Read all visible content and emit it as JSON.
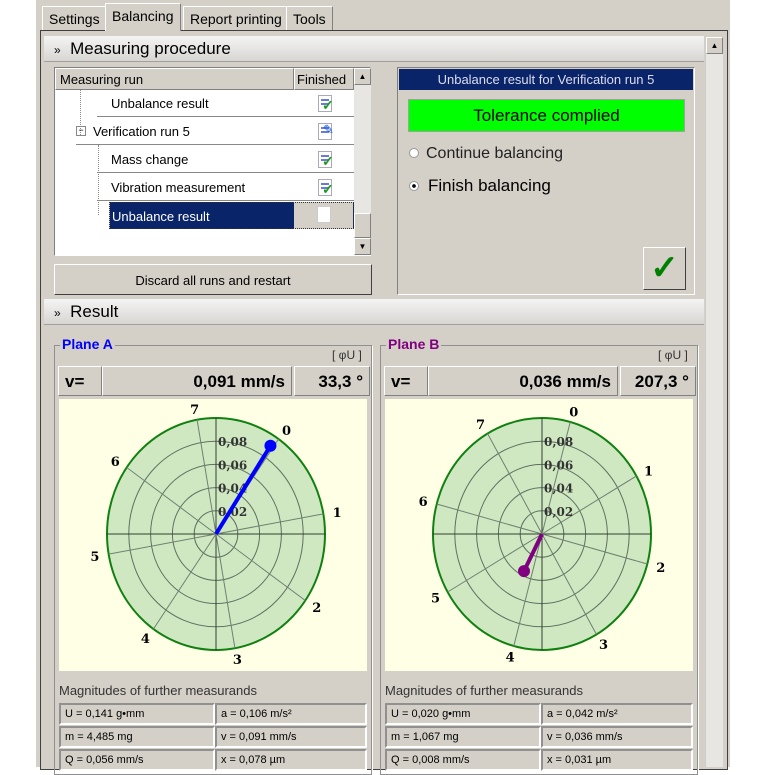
{
  "tabs": [
    {
      "label": "Settings"
    },
    {
      "label": "Balancing",
      "active": true
    },
    {
      "label": "Report printing"
    },
    {
      "label": "Tools"
    }
  ],
  "measuring_procedure": {
    "title": "Measuring procedure",
    "tree": {
      "columns": [
        "Measuring run",
        "Finished"
      ],
      "rows": [
        {
          "label": "Unbalance result",
          "status": "done-icon"
        },
        {
          "label": "Verification run 5",
          "status": "in-progress-icon",
          "expanded": true
        },
        {
          "label": "Mass change",
          "status": "done-icon"
        },
        {
          "label": "Vibration measurement",
          "status": "done-icon"
        },
        {
          "label": "Unbalance result",
          "status": "empty-doc-icon",
          "selected": true
        }
      ]
    },
    "discard_button": "Discard all runs and restart",
    "result_panel": {
      "title": "Unbalance result for Verification run 5",
      "status": "Tolerance complied",
      "status_color": "#00ff00",
      "options": [
        {
          "label": "Continue balancing",
          "selected": false
        },
        {
          "label": "Finish balancing",
          "selected": true
        }
      ],
      "confirm_icon": "checkmark-icon"
    }
  },
  "result": {
    "title": "Result",
    "unit_label": "[ φU ]",
    "measurands_title": "Magnitudes of further measurands",
    "planes": [
      {
        "name": "Plane A",
        "color": "#0000ff",
        "v_label": "v=",
        "velocity": "0,091 mm/s",
        "angle": "33,3 °",
        "measurands": [
          "U = 0,141 g•mm",
          "a = 0,106 m/s²",
          "m = 4,485 mg",
          "v = 0,091 mm/s",
          "Q = 0,056 mm/s",
          "x = 0,078 µm"
        ]
      },
      {
        "name": "Plane B",
        "color": "#800080",
        "v_label": "v=",
        "velocity": "0,036 mm/s",
        "angle": "207,3 °",
        "measurands": [
          "U = 0,020 g•mm",
          "a = 0,042 m/s²",
          "m = 1,067 mg",
          "v = 0,036 mm/s",
          "Q = 0,008 mm/s",
          "x = 0,031 µm"
        ]
      }
    ]
  },
  "chart_data": [
    {
      "type": "polar",
      "title": "Plane A",
      "radial_ticks": [
        "0,02",
        "0,04",
        "0,06",
        "0,08"
      ],
      "rmax": 0.1,
      "sector_labels": [
        "0",
        "1",
        "2",
        "3",
        "4",
        "5",
        "6",
        "7"
      ],
      "sector_label_offset_deg": 35,
      "point": {
        "magnitude": 0.091,
        "angle_deg": 33.3
      },
      "color": "#0000ff"
    },
    {
      "type": "polar",
      "title": "Plane B",
      "radial_ticks": [
        "0,02",
        "0,04",
        "0,06",
        "0,08"
      ],
      "rmax": 0.1,
      "sector_labels": [
        "0",
        "1",
        "2",
        "3",
        "4",
        "5",
        "6",
        "7"
      ],
      "sector_label_offset_deg": 15,
      "point": {
        "magnitude": 0.036,
        "angle_deg": 207.3
      },
      "color": "#800080"
    }
  ]
}
